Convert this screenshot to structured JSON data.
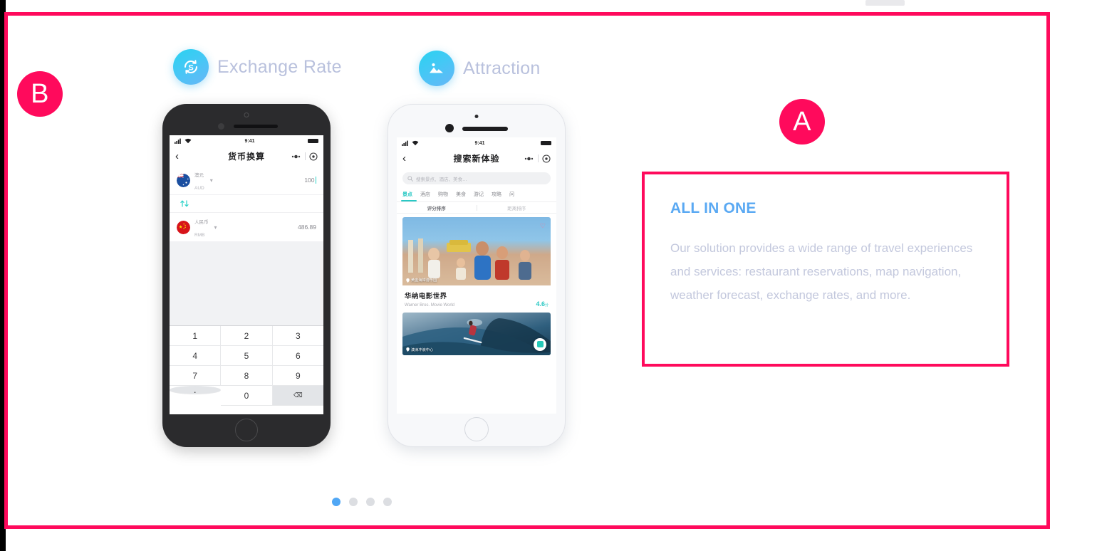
{
  "annotations": {
    "badge_a": "A",
    "badge_b": "B",
    "accent_color": "#ff0a5c"
  },
  "features": [
    {
      "label": "Exchange Rate",
      "icon": "currency-exchange-icon"
    },
    {
      "label": "Attraction",
      "icon": "mountain-landscape-icon"
    }
  ],
  "phone_left": {
    "status": {
      "time": "9:41",
      "signal": "signal-icon",
      "wifi": "wifi-icon",
      "battery": "battery-icon"
    },
    "nav": {
      "back": "‹",
      "title": "货币换算",
      "action_more": "more-icon",
      "action_target": "target-icon"
    },
    "rows": [
      {
        "name": "澳元",
        "code": "AUD",
        "value": "100",
        "flag": "australia-flag"
      },
      {
        "name": "人民币",
        "code": "RMB",
        "value": "486.89",
        "flag": "china-flag"
      }
    ],
    "swap_icon": "swap-vertical-icon",
    "keypad": [
      [
        "1",
        "2",
        "3"
      ],
      [
        "4",
        "5",
        "6"
      ],
      [
        "7",
        "8",
        "9"
      ],
      [
        ".",
        "0",
        "⌫"
      ]
    ]
  },
  "phone_right": {
    "status": {
      "time": "9:41",
      "signal": "signal-icon",
      "wifi": "wifi-icon",
      "battery": "battery-icon"
    },
    "nav": {
      "back": "‹",
      "title": "搜索新体验",
      "action_more": "more-icon",
      "action_target": "target-icon"
    },
    "search": {
      "placeholder": "搜索景点、酒店、美食…",
      "icon": "search-icon"
    },
    "tabs": [
      {
        "label": "景点",
        "active": true
      },
      {
        "label": "酒店",
        "active": false
      },
      {
        "label": "购物",
        "active": false
      },
      {
        "label": "美食",
        "active": false
      },
      {
        "label": "游记",
        "active": false
      },
      {
        "label": "攻略",
        "active": false
      },
      {
        "label": "问",
        "active": false
      }
    ],
    "sort": [
      {
        "label": "评分排序",
        "active": true
      },
      {
        "label": "距离排序",
        "active": false
      }
    ],
    "cards": [
      {
        "title": "华纳电影世界",
        "subtitle": "Warner Bros. Movie World",
        "rating": "4.6",
        "rating_unit": "分",
        "geo": "黄金海岸游乐园",
        "favorite_icon": "heart-icon",
        "image": "beach-family-photo"
      },
      {
        "geo": "澳洲冲浪中心",
        "image": "surfing-wave-photo",
        "fab_icon": "video-icon"
      }
    ]
  },
  "pagination": {
    "count": 4,
    "active_index": 0,
    "active_color": "#50a7f5",
    "inactive_color": "#dcdee2"
  },
  "panel_a": {
    "title": "ALL IN ONE",
    "body": "Our solution provides a wide range of travel experiences and services: restaurant reservations, map navigation, weather forecast, exchange rates, and more.",
    "title_color": "#5aa9f3"
  }
}
